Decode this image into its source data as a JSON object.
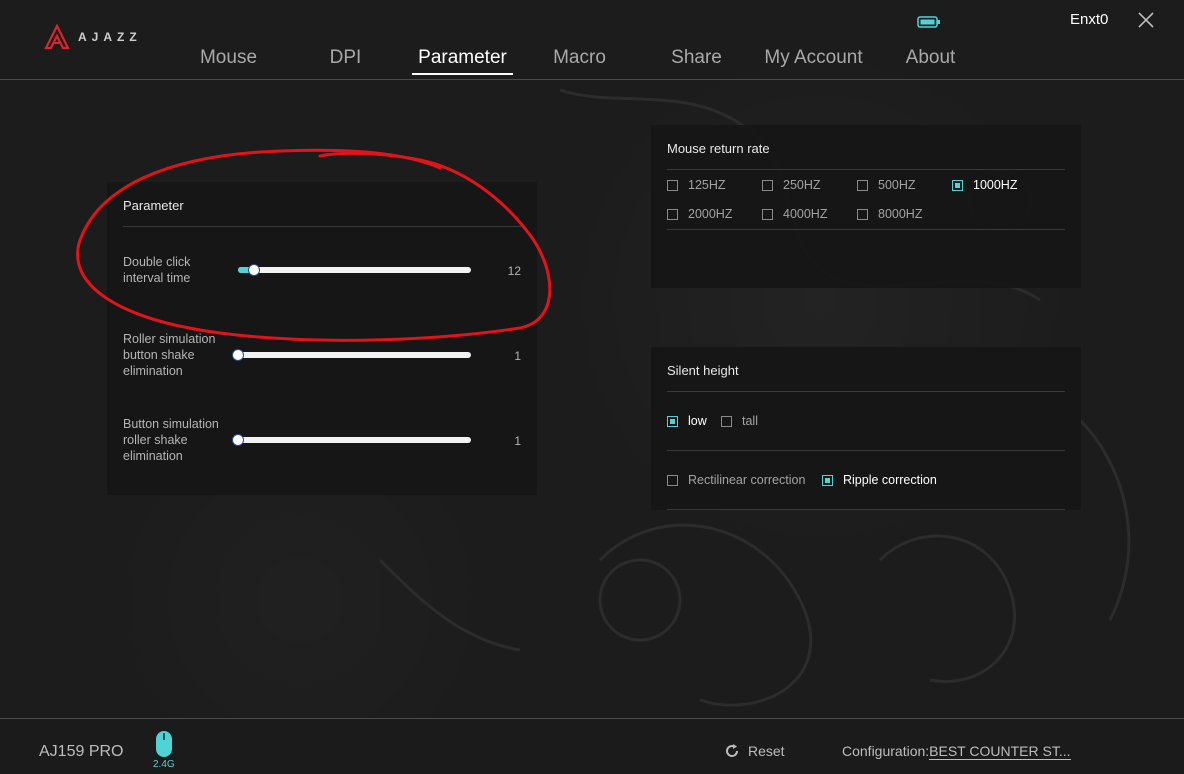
{
  "brand": {
    "logo_text": "AJAZZ"
  },
  "nav": {
    "tabs": [
      {
        "label": "Mouse"
      },
      {
        "label": "DPI"
      },
      {
        "label": "Parameter"
      },
      {
        "label": "Macro"
      },
      {
        "label": "Share"
      },
      {
        "label": "My Account"
      },
      {
        "label": "About"
      }
    ],
    "active": "Parameter"
  },
  "user": {
    "name": "Enxt0"
  },
  "parameter_panel": {
    "title": "Parameter",
    "sliders": [
      {
        "label_lines": [
          "Double click",
          "interval time"
        ],
        "value": "12",
        "fraction": 0.07
      },
      {
        "label_lines": [
          "Roller simulation",
          "button shake",
          "elimination"
        ],
        "value": "1",
        "fraction": 0.0
      },
      {
        "label_lines": [
          "Button simulation",
          "roller shake",
          "elimination"
        ],
        "value": "1",
        "fraction": 0.0
      }
    ]
  },
  "return_rate_panel": {
    "title": "Mouse return rate",
    "options": [
      {
        "label": "125HZ",
        "checked": false
      },
      {
        "label": "250HZ",
        "checked": false
      },
      {
        "label": "500HZ",
        "checked": false
      },
      {
        "label": "1000HZ",
        "checked": true
      },
      {
        "label": "2000HZ",
        "checked": false
      },
      {
        "label": "4000HZ",
        "checked": false
      },
      {
        "label": "8000HZ",
        "checked": false
      }
    ]
  },
  "silent_panel": {
    "title": "Silent height",
    "height_options": [
      {
        "label": "low",
        "checked": true
      },
      {
        "label": "tall",
        "checked": false
      }
    ],
    "correction_options": [
      {
        "label": "Rectilinear correction",
        "checked": false
      },
      {
        "label": "Ripple correction",
        "checked": true
      }
    ]
  },
  "footer": {
    "device": "AJ159 PRO",
    "connection": "2.4G",
    "reset_label": "Reset",
    "config_label": "Configuration:",
    "config_value": "BEST COUNTER ST..."
  },
  "colors": {
    "accent": "#4fd3d6",
    "annotation": "#e0141b",
    "logo_red": "#d8262d"
  },
  "icons": [
    "ajazz-logo-icon",
    "battery-icon",
    "close-icon",
    "mouse-icon",
    "reset-icon"
  ]
}
